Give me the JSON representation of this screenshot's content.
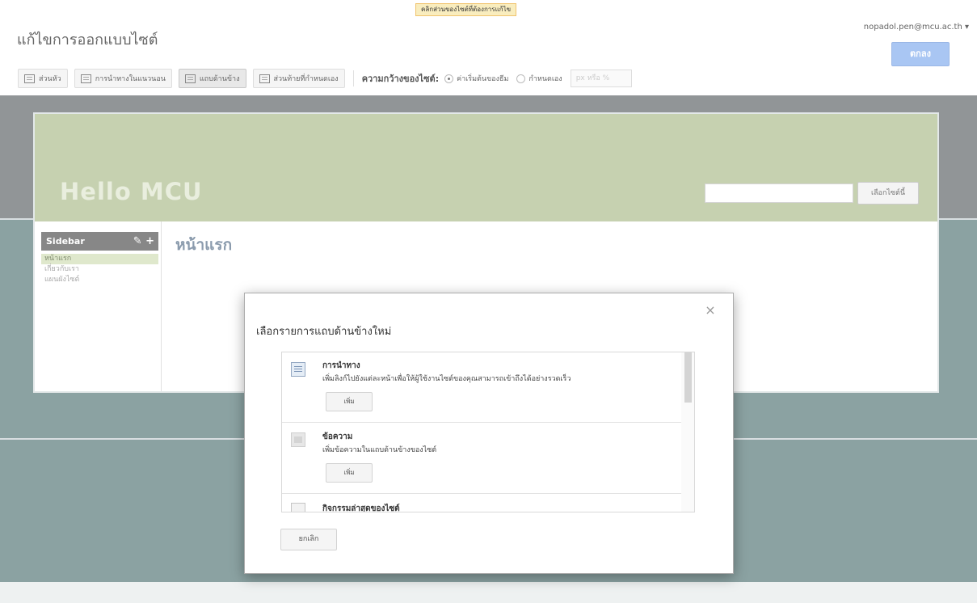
{
  "hint": "คลิกส่วนของไซต์ที่ต้องการแก้ไข",
  "header": {
    "title": "แก้ไขการออกแบบไซต์",
    "user": "nopadol.pen@mcu.ac.th ▾",
    "ok_label": "ตกลง"
  },
  "toolbar": {
    "buttons": [
      "ส่วนหัว",
      "การนำทางในแนวนอน",
      "แถบด้านข้าง",
      "ส่วนท้ายที่กำหนดเอง"
    ],
    "width_label": "ความกว้างของไซต์:",
    "option_default": "ค่าเริ่มต้นของธีม",
    "option_custom": "กำหนดเอง",
    "px_placeholder": "px หรือ %"
  },
  "site": {
    "title": "Hello MCU",
    "search_button": "เลือกไซต์นี้",
    "sidebar_title": "Sidebar",
    "sidebar_tools": "✎ +",
    "sidebar_items": [
      "หน้าแรก",
      "เกี่ยวกับเรา",
      "แผนผังไซต์"
    ],
    "page_heading": "หน้าแรก"
  },
  "dialog": {
    "title": "เลือกรายการแถบด้านข้างใหม่",
    "close": "×",
    "gadgets": [
      {
        "name": "การนำทาง",
        "description": "เพิ่มลิงก์ไปยังแต่ละหน้าเพื่อให้ผู้ใช้งานไซต์ของคุณสามารถเข้าถึงได้อย่างรวดเร็ว",
        "add_label": "เพิ่ม",
        "icon": "navigation-icon"
      },
      {
        "name": "ข้อความ",
        "description": "เพิ่มข้อความในแถบด้านข้างของไซต์",
        "add_label": "เพิ่ม",
        "icon": "text-icon"
      },
      {
        "name": "กิจกรรมล่าสุดของไซต์",
        "description": "",
        "add_label": "",
        "icon": "activity-icon"
      }
    ],
    "cancel_label": "ยกเลิก"
  }
}
